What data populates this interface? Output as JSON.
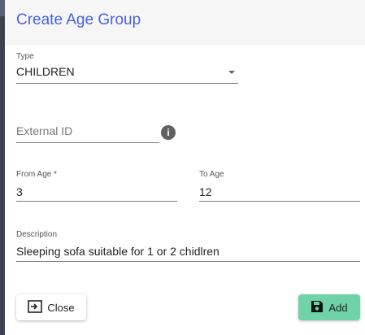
{
  "dialog": {
    "title": "Create Age Group"
  },
  "form": {
    "type": {
      "label": "Type",
      "value": "CHILDREN"
    },
    "external_id": {
      "placeholder": "External ID",
      "info_icon": "info-icon"
    },
    "from_age": {
      "label": "From Age *",
      "value": "3"
    },
    "to_age": {
      "label": "To Age",
      "value": "12"
    },
    "description": {
      "label": "Description",
      "value": "Sleeping sofa suitable for 1 or 2 chidlren"
    }
  },
  "actions": {
    "close_label": "Close",
    "close_icon": "exit-box-icon",
    "add_label": "Add",
    "add_icon": "save-icon"
  },
  "colors": {
    "title": "#4a63d6",
    "add_button": "#6fd3a7"
  }
}
